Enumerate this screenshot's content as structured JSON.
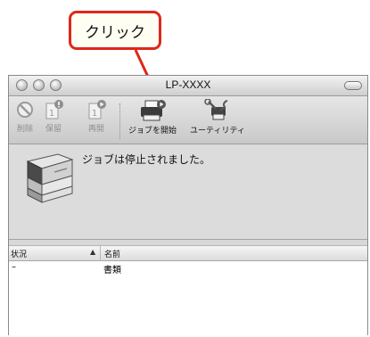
{
  "callout": {
    "label": "クリック"
  },
  "window": {
    "title": "LP-XXXX"
  },
  "toolbar": {
    "delete_label": "削除",
    "hold_label": "保留",
    "resume_label": "再開",
    "start_jobs_label": "ジョブを開始",
    "utility_label": "ユーティリティ"
  },
  "status": {
    "message": "ジョブは停止されました。"
  },
  "job_list": {
    "columns": [
      "状況",
      "名前"
    ],
    "rows": [
      {
        "status": "–",
        "name": "書類"
      }
    ]
  },
  "colors": {
    "callout_border": "#e0261a",
    "arrow": "#e0261a"
  }
}
